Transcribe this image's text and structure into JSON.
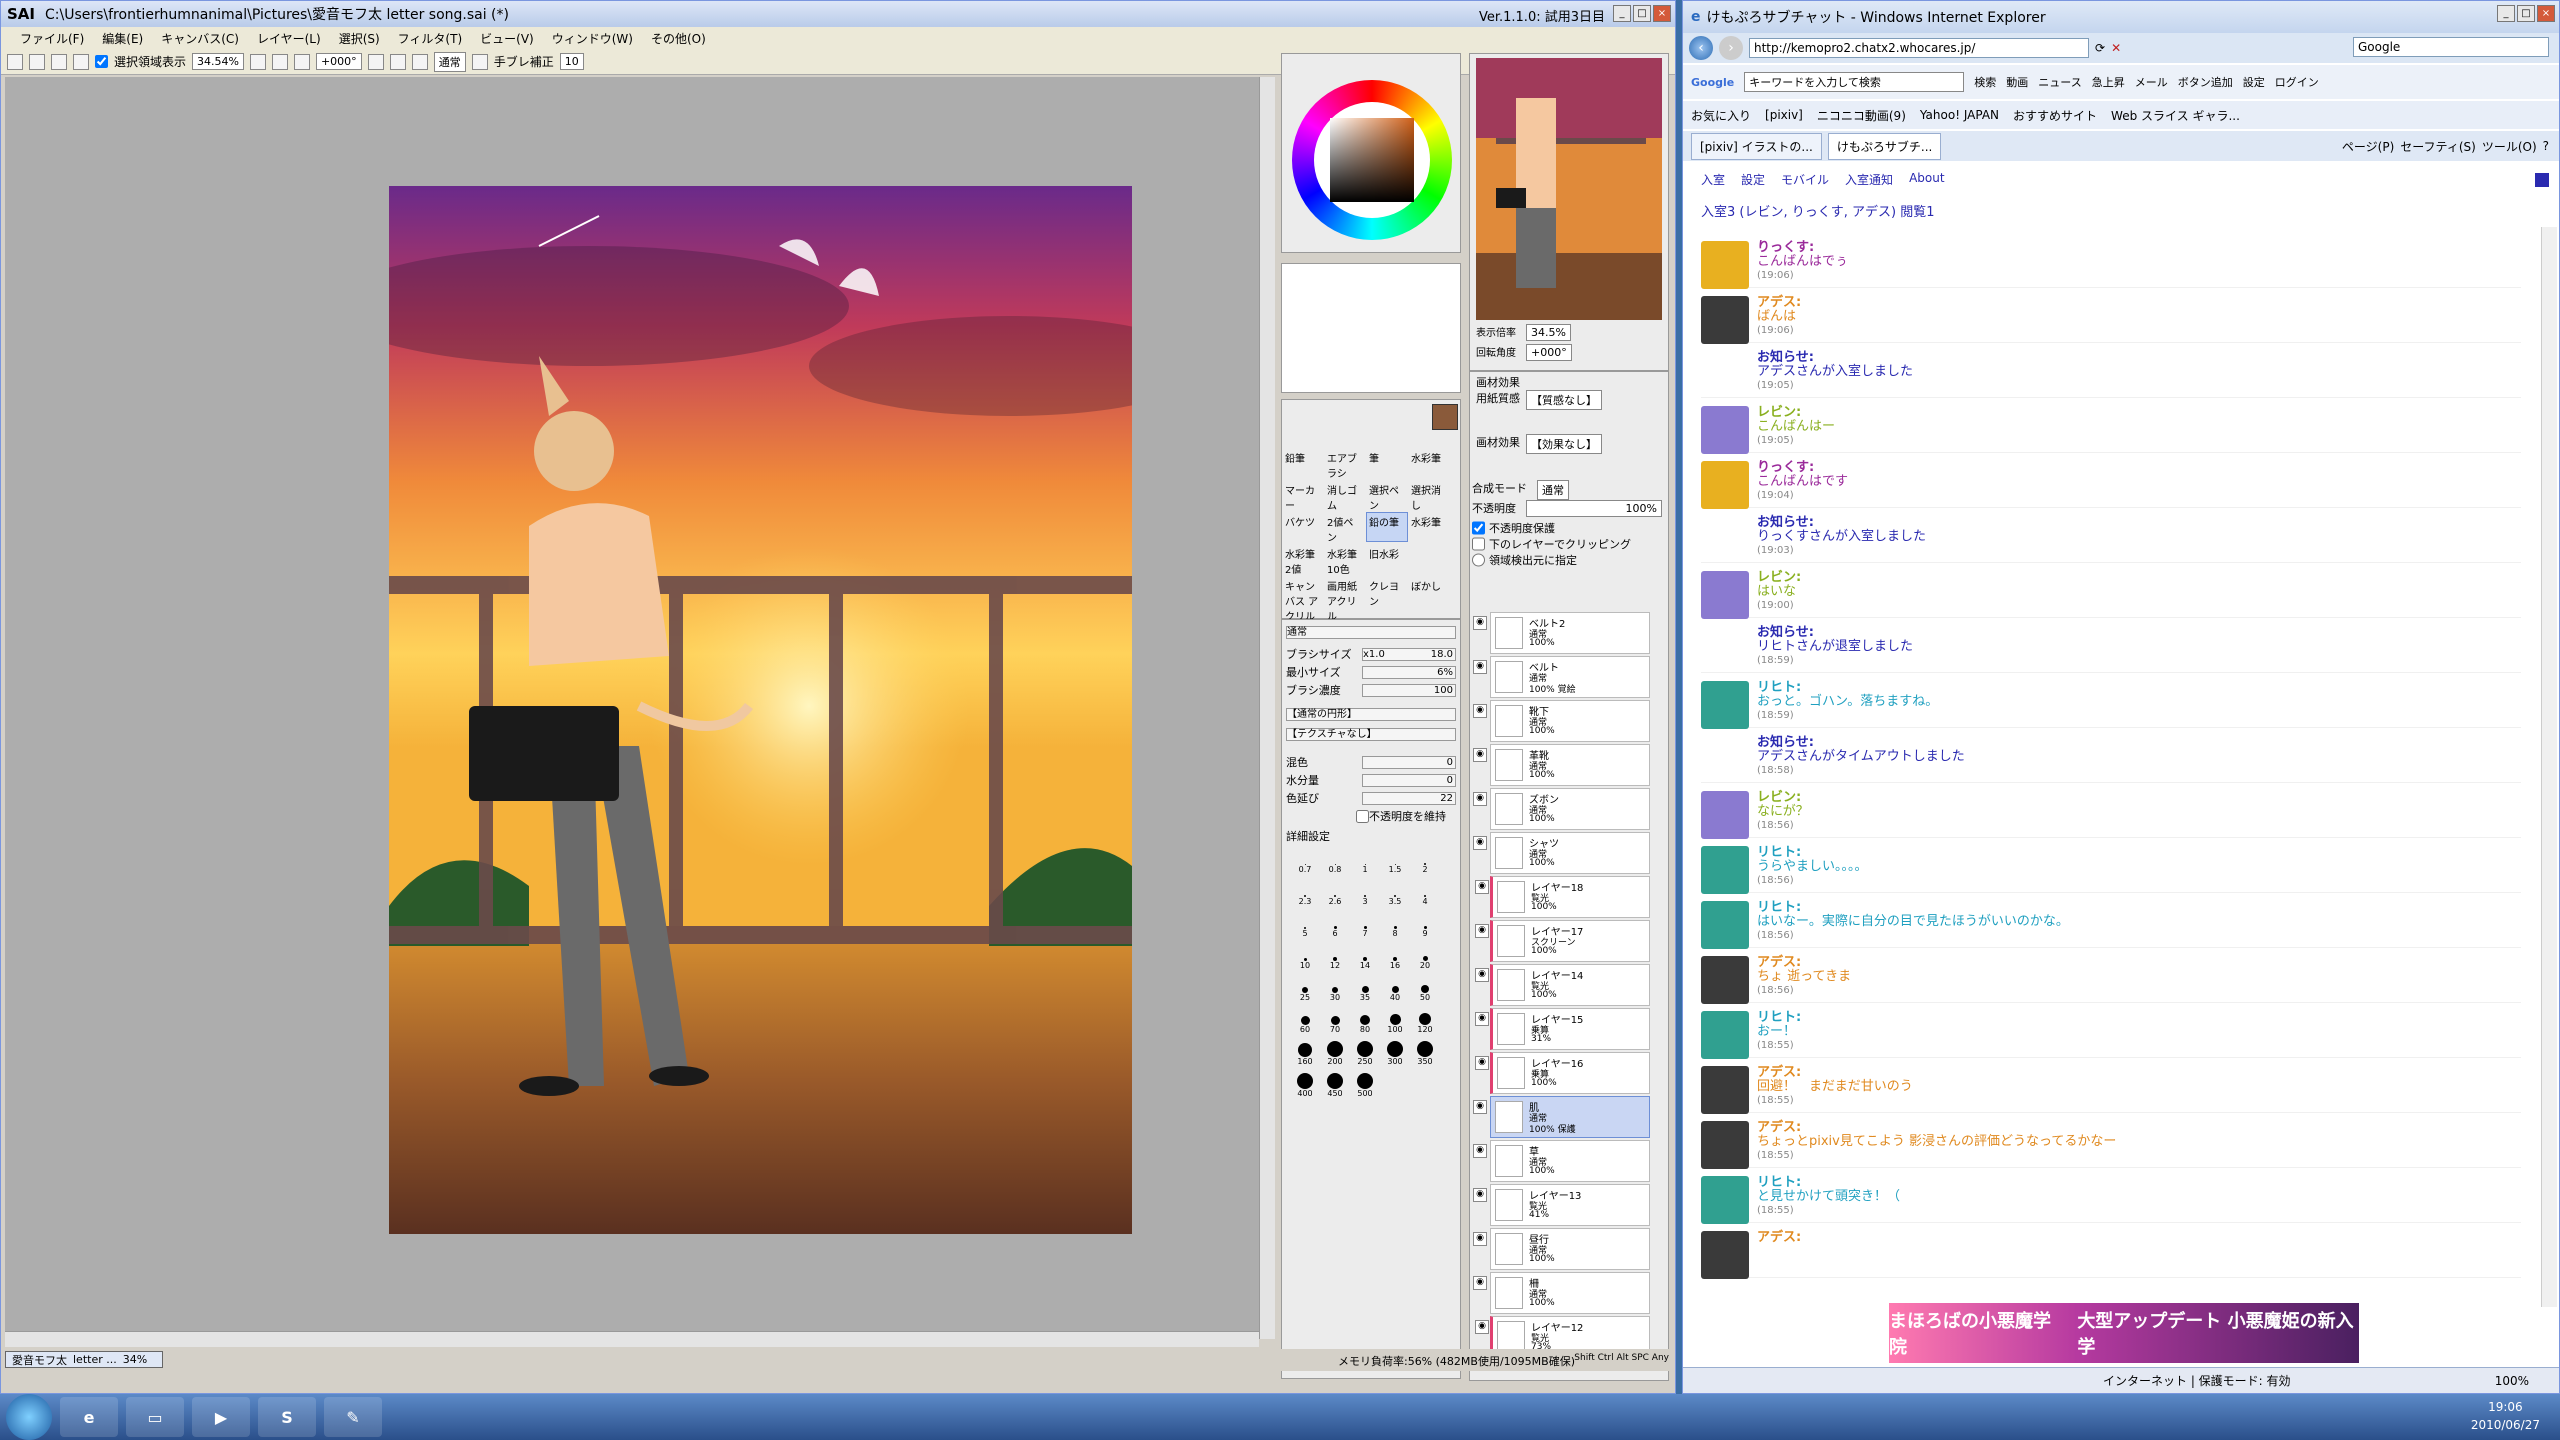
{
  "sai": {
    "title": "C:\\Users\\frontierhumnanimal\\Pictures\\愛音モフ太 letter song.sai (*)",
    "app": "SAI",
    "version": "Ver.1.1.0: 試用3日目",
    "menu": [
      "ファイル(F)",
      "編集(E)",
      "キャンバス(C)",
      "レイヤー(L)",
      "選択(S)",
      "フィルタ(T)",
      "ビュー(V)",
      "ウィンドウ(W)",
      "その他(O)"
    ],
    "toolbar": {
      "selection_label": "選択領域表示",
      "zoom": "34.54%",
      "angle": "+000°",
      "blend": "通常",
      "stab_label": "手ブレ補正",
      "stab_value": "10"
    },
    "status": {
      "tab_name": "愛音モフ太",
      "tab_file": "letter ...",
      "tab_zoom": "34%",
      "memory": "メモリ負荷率:56% (482MB使用/1095MB確保)",
      "keys": "Shift Ctrl Alt SPC Any"
    }
  },
  "navigator": {
    "zoom_label": "表示倍率",
    "zoom": "34.5%",
    "angle_label": "回転角度",
    "angle": "+000°"
  },
  "tools": {
    "items": [
      "鉛筆",
      "エアブラシ",
      "筆",
      "水彩筆",
      "マーカー",
      "消しゴム",
      "選択ペン",
      "選択消し",
      "バケツ",
      "2値ペン",
      "鉛の筆",
      "水彩筆",
      "水彩筆 2値",
      "水彩筆 10色",
      "旧水彩",
      "",
      "キャンバス アクリル",
      "画用紙 アクリル",
      "クレヨン",
      "ぼかし"
    ],
    "selected_index": 10
  },
  "brush": {
    "mode": "通常",
    "size_label": "ブラシサイズ",
    "size_mult": "x1.0",
    "size": "18.0",
    "min_label": "最小サイズ",
    "min": "6%",
    "density_label": "ブラシ濃度",
    "density": "100",
    "shape": "【通常の円形】",
    "texture": "【テクスチャなし】",
    "mix_label": "混色",
    "mix": "0",
    "water_label": "水分量",
    "water": "0",
    "stretch_label": "色延び",
    "stretch": "22",
    "keep_opacity": "不透明度を維持",
    "detail": "詳細設定",
    "sizes": [
      "0.7",
      "0.8",
      "1",
      "1.5",
      "2",
      "2.3",
      "2.6",
      "3",
      "3.5",
      "4",
      "5",
      "6",
      "7",
      "8",
      "9",
      "10",
      "12",
      "14",
      "16",
      "20",
      "25",
      "30",
      "35",
      "40",
      "50",
      "60",
      "70",
      "80",
      "100",
      "120",
      "160",
      "200",
      "250",
      "300",
      "350",
      "400",
      "450",
      "500"
    ]
  },
  "layer_panel": {
    "paper_label": "画材効果",
    "paper_tex_label": "用紙質感",
    "paper_tex": "【質感なし】",
    "paper_fx_label": "画材効果",
    "paper_fx": "【効果なし】",
    "blend_label": "合成モード",
    "blend": "通常",
    "opacity_label": "不透明度",
    "opacity": "100%",
    "opt1": "不透明度保護",
    "opt2": "下のレイヤーでクリッピング",
    "opt3": "領域検出元に指定",
    "layers": [
      {
        "name": "ベルト2",
        "mode": "通常",
        "opacity": "100%"
      },
      {
        "name": "ベルト",
        "mode": "通常",
        "opacity": "100% 覚絵"
      },
      {
        "name": "靴下",
        "mode": "通常",
        "opacity": "100%"
      },
      {
        "name": "革靴",
        "mode": "通常",
        "opacity": "100%"
      },
      {
        "name": "ズボン",
        "mode": "通常",
        "opacity": "100%"
      },
      {
        "name": "シャツ",
        "mode": "通常",
        "opacity": "100%"
      },
      {
        "name": "レイヤー18",
        "mode": "覧光",
        "opacity": "100%"
      },
      {
        "name": "レイヤー17",
        "mode": "スクリーン",
        "opacity": "100%"
      },
      {
        "name": "レイヤー14",
        "mode": "覧光",
        "opacity": "100%"
      },
      {
        "name": "レイヤー15",
        "mode": "乗算",
        "opacity": "31%"
      },
      {
        "name": "レイヤー16",
        "mode": "乗算",
        "opacity": "100%"
      },
      {
        "name": "肌",
        "mode": "通常",
        "opacity": "100% 保護"
      },
      {
        "name": "草",
        "mode": "通常",
        "opacity": "100%"
      },
      {
        "name": "レイヤー13",
        "mode": "覧光",
        "opacity": "41%"
      },
      {
        "name": "昼行",
        "mode": "通常",
        "opacity": "100%"
      },
      {
        "name": "柵",
        "mode": "通常",
        "opacity": "100%"
      },
      {
        "name": "レイヤー12",
        "mode": "覧光",
        "opacity": "73%"
      }
    ]
  },
  "ie": {
    "title": "けもぷろサブチャット - Windows Internet Explorer",
    "url": "http://kemopro2.chatx2.whocares.jp/",
    "search_engine": "Google",
    "gbar_placeholder": "キーワードを入力して検索",
    "gbar_items": [
      "検索",
      "動画",
      "ニュース",
      "急上昇",
      "メール",
      "ボタン追加",
      "設定",
      "ログイン"
    ],
    "favorites": [
      "お気に入り",
      "[pixiv]",
      "ニコニコ動画(9)",
      "Yahoo! JAPAN",
      "おすすめサイト",
      "Web スライス ギャラ..."
    ],
    "tabs": [
      "[pixiv] イラストの...",
      "けもぷろサブチ..."
    ],
    "tools": [
      "ページ(P)",
      "セーフティ(S)",
      "ツール(O)"
    ],
    "chat_nav": [
      "入室",
      "設定",
      "モバイル",
      "入室通知",
      "About"
    ],
    "room_info": "入室3 (レビン, りっくす, アデス) 閲覧1",
    "messages": [
      {
        "name": "りっくす:",
        "text": "こんばんはでぅ",
        "time": "(19:06)",
        "color": "#9a2a9a",
        "av": "#e8b020"
      },
      {
        "name": "アデス:",
        "text": "ばんは",
        "time": "(19:06)",
        "color": "#e08a20",
        "av": "#3a3a3a"
      },
      {
        "name": "お知らせ:",
        "text": "アデスさんが入室しました",
        "time": "(19:05)",
        "color": "#2a2ab0",
        "av": ""
      },
      {
        "name": "レビン:",
        "text": "こんばんはー",
        "time": "(19:05)",
        "color": "#8ab020",
        "av": "#8a7ad0"
      },
      {
        "name": "りっくす:",
        "text": "こんばんはです",
        "time": "(19:04)",
        "color": "#9a2a9a",
        "av": "#e8b020"
      },
      {
        "name": "お知らせ:",
        "text": "りっくすさんが入室しました",
        "time": "(19:03)",
        "color": "#2a2ab0",
        "av": ""
      },
      {
        "name": "レビン:",
        "text": "はいな",
        "time": "(19:00)",
        "color": "#8ab020",
        "av": "#8a7ad0"
      },
      {
        "name": "お知らせ:",
        "text": "リヒトさんが退室しました",
        "time": "(18:59)",
        "color": "#2a2ab0",
        "av": ""
      },
      {
        "name": "リヒト:",
        "text": "おっと。ゴハン。落ちますね。",
        "time": "(18:59)",
        "color": "#20a0c0",
        "av": "#30a090"
      },
      {
        "name": "お知らせ:",
        "text": "アデスさんがタイムアウトしました",
        "time": "(18:58)",
        "color": "#2a2ab0",
        "av": ""
      },
      {
        "name": "レビン:",
        "text": "なにが？",
        "time": "(18:56)",
        "color": "#8ab020",
        "av": "#8a7ad0"
      },
      {
        "name": "リヒト:",
        "text": "うらやましい。。。。",
        "time": "(18:56)",
        "color": "#20a0c0",
        "av": "#30a090"
      },
      {
        "name": "リヒト:",
        "text": "はいなー。実際に自分の目で見たほうがいいのかな。",
        "time": "(18:56)",
        "color": "#20a0c0",
        "av": "#30a090"
      },
      {
        "name": "アデス:",
        "text": "ちょ 逝ってきま",
        "time": "(18:56)",
        "color": "#e08a20",
        "av": "#3a3a3a"
      },
      {
        "name": "リヒト:",
        "text": "おー！",
        "time": "(18:55)",
        "color": "#20a0c0",
        "av": "#30a090"
      },
      {
        "name": "アデス:",
        "text": "回避！　まだまだ甘いのう",
        "time": "(18:55)",
        "color": "#e08a20",
        "av": "#3a3a3a"
      },
      {
        "name": "アデス:",
        "text": "ちょっとpixiv見てこよう 影浸さんの評価どうなってるかなー",
        "time": "(18:55)",
        "color": "#e08a20",
        "av": "#3a3a3a"
      },
      {
        "name": "リヒト:",
        "text": "と見せかけて頭突き！（",
        "time": "(18:55)",
        "color": "#20a0c0",
        "av": "#30a090"
      },
      {
        "name": "アデス:",
        "text": "",
        "time": "",
        "color": "#e08a20",
        "av": "#3a3a3a"
      }
    ],
    "banner_left": "まほろばの小悪魔学院",
    "banner_right": "大型アップデート 小悪魔姫の新入学",
    "status_zone": "インターネット | 保護モード: 有効",
    "status_zoom": "100%"
  },
  "taskbar": {
    "time": "19:06",
    "date": "2010/06/27"
  }
}
